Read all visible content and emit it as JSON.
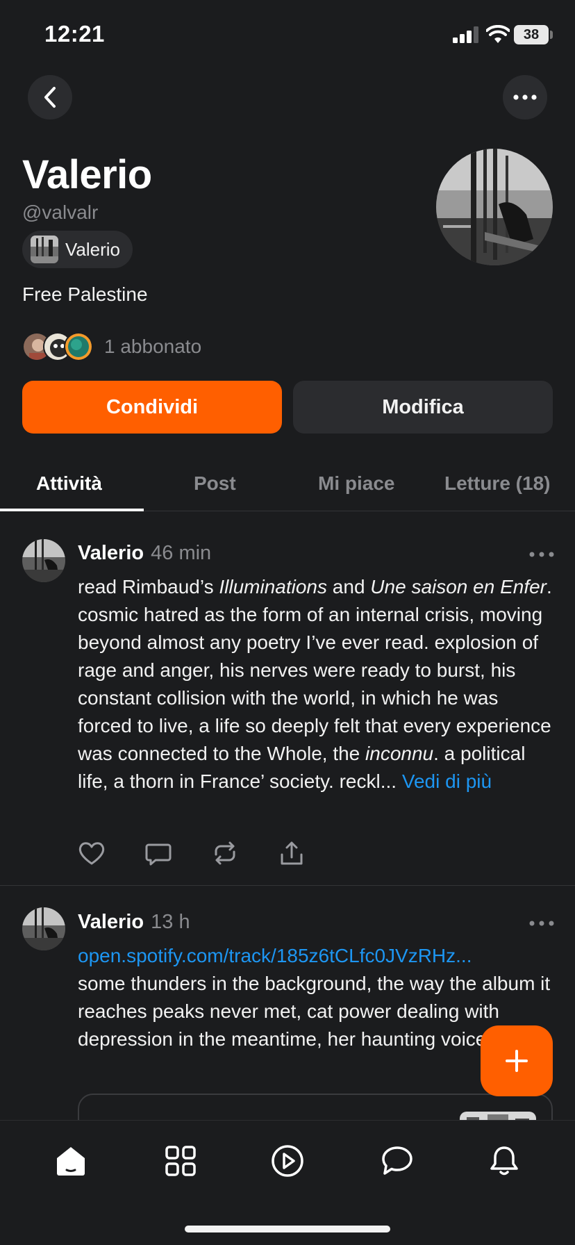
{
  "status_bar": {
    "time": "12:21",
    "battery": "38"
  },
  "profile": {
    "name": "Valerio",
    "handle": "@valvalr",
    "publication": "Valerio",
    "bio": "Free Palestine",
    "subscribers": "1 abbonato"
  },
  "buttons": {
    "share": "Condividi",
    "edit": "Modifica"
  },
  "tabs": [
    {
      "label": "Attività",
      "active": true
    },
    {
      "label": "Post",
      "active": false
    },
    {
      "label": "Mi piace",
      "active": false
    },
    {
      "label": "Letture (18)",
      "active": false
    }
  ],
  "posts": [
    {
      "author": "Valerio",
      "time": "46 min",
      "t1": "read Rimbaud’s ",
      "t1_italic": "Illuminations",
      "t2": " and ",
      "t2_italic": "Une saison en Enfer",
      "t3": ". cosmic hatred as the form of an internal crisis, moving beyond almost any poetry I’ve ever read. explosion of rage and anger, his nerves were ready to burst, his constant collision with the world, in which he was forced to live, a life so deeply felt that every experience was connected to the Whole, the ",
      "t3_italic": "inconnu",
      "t4": ". a political life, a thorn in France’ society. reckl... ",
      "more": "Vedi di più"
    },
    {
      "author": "Valerio",
      "time": "13 h",
      "link": "open.spotify.com/track/185z6tCLfc0JVzRHz...",
      "text": "some thunders in the background, the way the album it reaches peaks never met, cat power dealing with depression in the meantime, her haunting voice"
    }
  ],
  "colors": {
    "accent": "#ff5f00",
    "link": "#1d96f2",
    "background": "#1b1c1e",
    "surface": "#2b2c2f"
  },
  "icons": {
    "nav": [
      "home-icon",
      "grid-icon",
      "play-icon",
      "chat-icon",
      "bell-icon"
    ],
    "post_actions": [
      "heart-icon",
      "comment-icon",
      "restack-icon",
      "share-icon"
    ]
  }
}
